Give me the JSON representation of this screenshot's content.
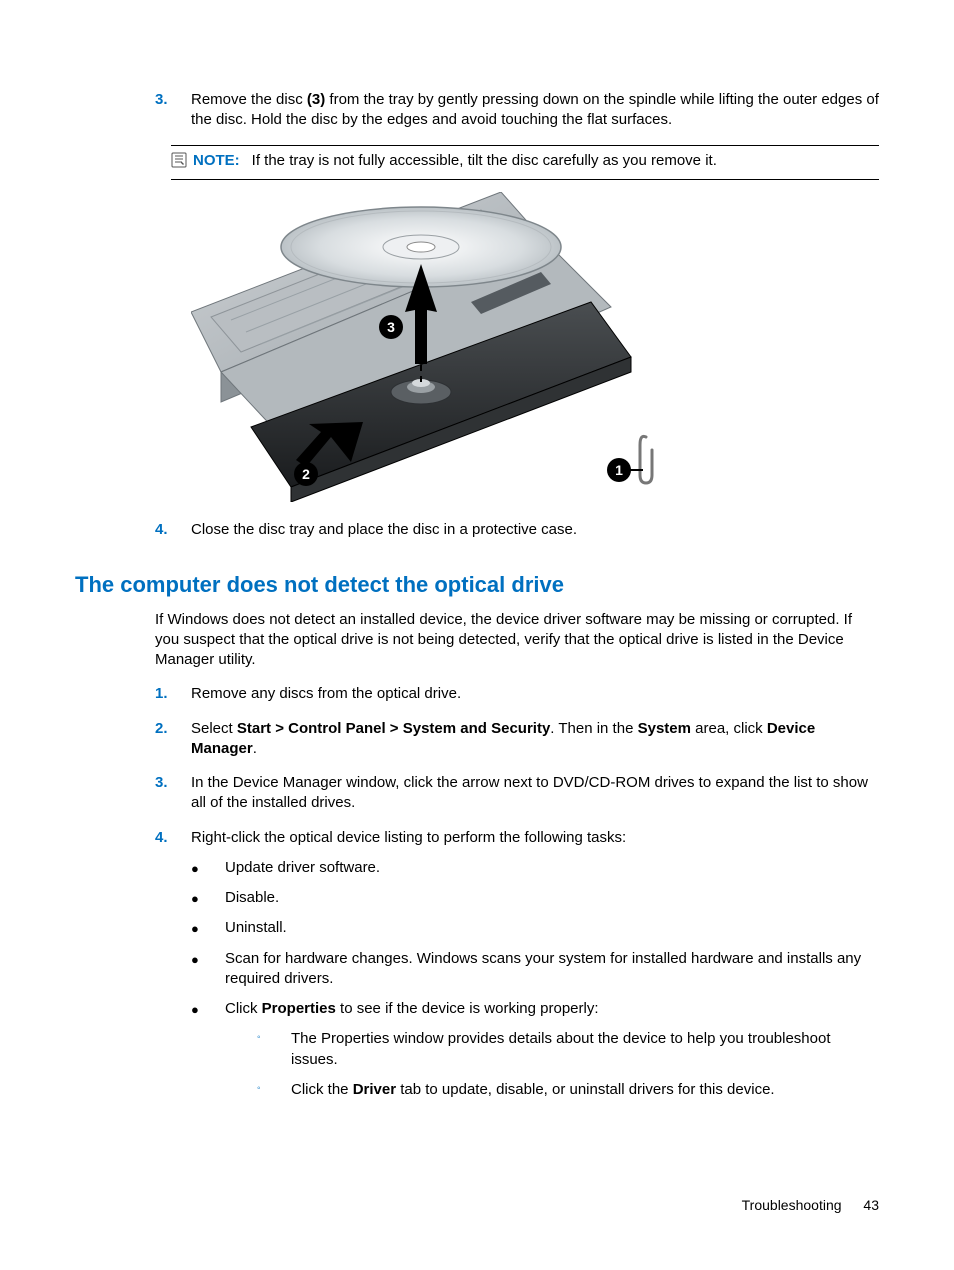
{
  "step3": {
    "num": "3.",
    "prefix": "Remove the disc ",
    "bold1": "(3)",
    "suffix": " from the tray by gently pressing down on the spindle while lifting the outer edges of the disc. Hold the disc by the edges and avoid touching the flat surfaces."
  },
  "note": {
    "label": "NOTE:",
    "text": "If the tray is not fully accessible, tilt the disc carefully as you remove it."
  },
  "figure": {
    "callout1": "1",
    "callout2": "2",
    "callout3": "3"
  },
  "step4": {
    "num": "4.",
    "text": "Close the disc tray and place the disc in a protective case."
  },
  "section_heading": "The computer does not detect the optical drive",
  "intro": "If Windows does not detect an installed device, the device driver software may be missing or corrupted. If you suspect that the optical drive is not being detected, verify that the optical drive is listed in the Device Manager utility.",
  "s2_1": {
    "num": "1.",
    "text": "Remove any discs from the optical drive."
  },
  "s2_2": {
    "num": "2.",
    "t1": "Select ",
    "b1": "Start > Control Panel > System and Security",
    "t2": ". Then in the ",
    "b2": "System",
    "t3": " area, click ",
    "b3": "Device Manager",
    "t4": "."
  },
  "s2_3": {
    "num": "3.",
    "text": "In the Device Manager window, click the arrow next to DVD/CD-ROM drives to expand the list to show all of the installed drives."
  },
  "s2_4": {
    "num": "4.",
    "text": "Right-click the optical device listing to perform the following tasks:"
  },
  "bullets": {
    "a": "Update driver software.",
    "b": "Disable.",
    "c": "Uninstall.",
    "d": "Scan for hardware changes. Windows scans your system for installed hardware and installs any required drivers.",
    "e_t1": "Click ",
    "e_b1": "Properties",
    "e_t2": " to see if the device is working properly:"
  },
  "sub": {
    "a": "The Properties window provides details about the device to help you troubleshoot issues.",
    "b_t1": "Click the ",
    "b_b1": "Driver",
    "b_t2": " tab to update, disable, or uninstall drivers for this device."
  },
  "footer": {
    "section": "Troubleshooting",
    "page": "43"
  }
}
